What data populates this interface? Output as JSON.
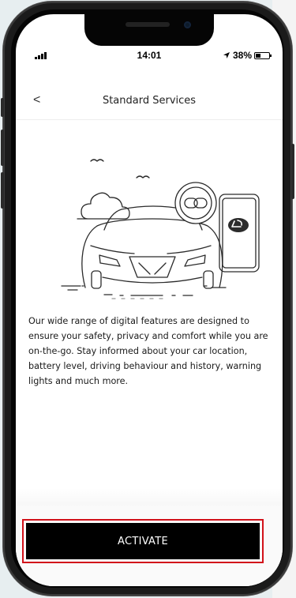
{
  "status_bar": {
    "time": "14:01",
    "battery_percent": "38%",
    "battery_level": 0.38
  },
  "nav": {
    "back_glyph": "<",
    "title": "Standard Services"
  },
  "illustration": {
    "icons": [
      "car-icon",
      "chain-link-icon",
      "smartphone-icon",
      "lexus-logo-icon",
      "cloud-icon",
      "bird-icon"
    ]
  },
  "content": {
    "description": "Our wide range of digital features are designed to ensure your safety, privacy and comfort while you are on-the-go. Stay informed about your car location, battery level, driving behaviour and history, warning lights and much more."
  },
  "footer": {
    "activate_label": "ACTIVATE"
  },
  "colors": {
    "highlight_border": "#d2121a",
    "button_bg": "#000000",
    "button_text": "#ffffff"
  }
}
